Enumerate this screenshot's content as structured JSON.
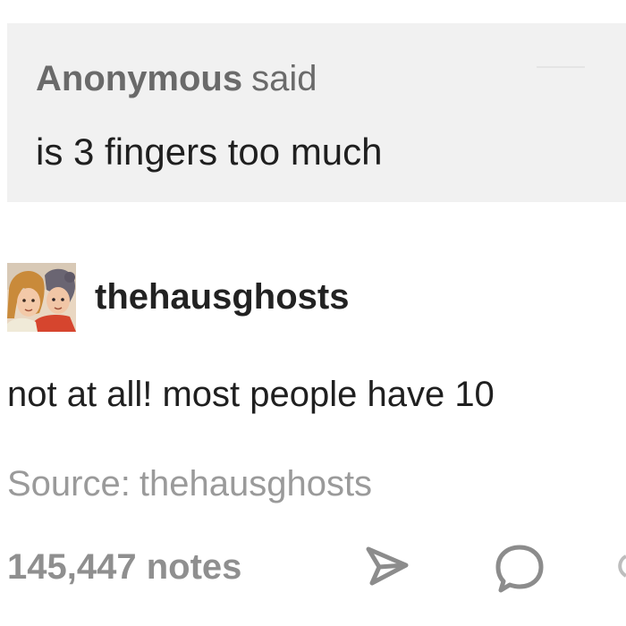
{
  "ask": {
    "asker_name": "Anonymous",
    "said_label": "said",
    "question": "is 3 fingers too much"
  },
  "post": {
    "author_name": "thehausghosts",
    "avatar_icon": "avatar-illustration",
    "answer": "not at all! most people have 10"
  },
  "source": {
    "label": "Source:",
    "name": "thehausghosts"
  },
  "footer": {
    "notes": "145,447 notes",
    "share_icon": "share-arrow-icon",
    "reply_icon": "reply-bubble-icon"
  },
  "colors": {
    "ask_background": "#f1f1f1",
    "muted_text": "#9a9a9a",
    "body_text": "#1f1f1f"
  }
}
